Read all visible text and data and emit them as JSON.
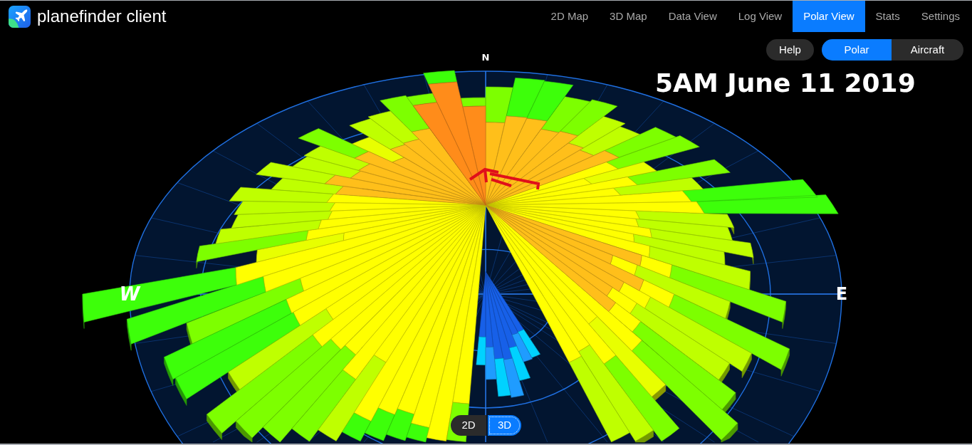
{
  "header": {
    "logo_text": "**plane**finder client",
    "nav": [
      {
        "label": "2D Map",
        "selected": false
      },
      {
        "label": "3D Map",
        "selected": false
      },
      {
        "label": "Data View",
        "selected": false
      },
      {
        "label": "Log View",
        "selected": false
      },
      {
        "label": "Polar View",
        "selected": true
      },
      {
        "label": "Stats",
        "selected": false
      },
      {
        "label": "Settings",
        "selected": false
      }
    ]
  },
  "toolbar": {
    "help": "Help",
    "modes": [
      {
        "label": "Polar",
        "selected": true
      },
      {
        "label": "Aircraft",
        "selected": false
      }
    ]
  },
  "overlay_title": "5AM June 11 2019",
  "polar_view": {
    "compass": [
      {
        "kind": "north",
        "label": "N"
      },
      {
        "kind": "west",
        "label": "W"
      },
      {
        "kind": "east",
        "label": "E"
      }
    ]
  },
  "view_toggle": [
    {
      "label": "2D",
      "selected": false
    },
    {
      "label": "3D",
      "selected": true
    }
  ]
}
